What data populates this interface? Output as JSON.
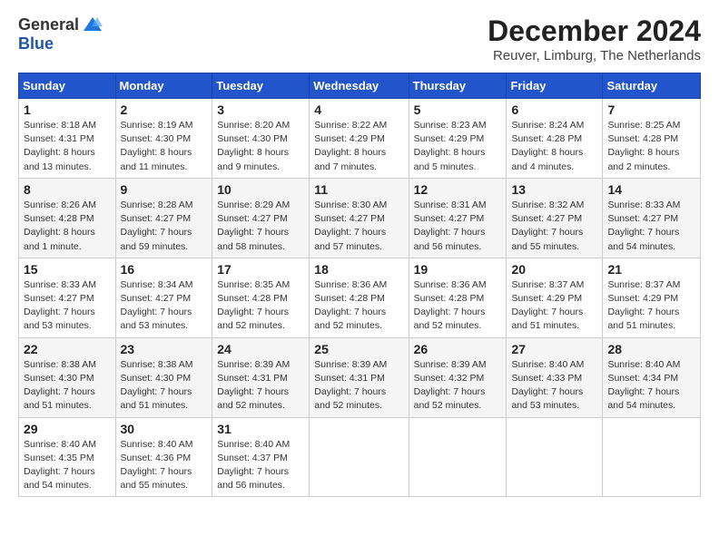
{
  "logo": {
    "general": "General",
    "blue": "Blue"
  },
  "title": "December 2024",
  "location": "Reuver, Limburg, The Netherlands",
  "weekdays": [
    "Sunday",
    "Monday",
    "Tuesday",
    "Wednesday",
    "Thursday",
    "Friday",
    "Saturday"
  ],
  "weeks": [
    [
      {
        "day": 1,
        "sunrise": "8:18 AM",
        "sunset": "4:31 PM",
        "daylight": "8 hours and 13 minutes."
      },
      {
        "day": 2,
        "sunrise": "8:19 AM",
        "sunset": "4:30 PM",
        "daylight": "8 hours and 11 minutes."
      },
      {
        "day": 3,
        "sunrise": "8:20 AM",
        "sunset": "4:30 PM",
        "daylight": "8 hours and 9 minutes."
      },
      {
        "day": 4,
        "sunrise": "8:22 AM",
        "sunset": "4:29 PM",
        "daylight": "8 hours and 7 minutes."
      },
      {
        "day": 5,
        "sunrise": "8:23 AM",
        "sunset": "4:29 PM",
        "daylight": "8 hours and 5 minutes."
      },
      {
        "day": 6,
        "sunrise": "8:24 AM",
        "sunset": "4:28 PM",
        "daylight": "8 hours and 4 minutes."
      },
      {
        "day": 7,
        "sunrise": "8:25 AM",
        "sunset": "4:28 PM",
        "daylight": "8 hours and 2 minutes."
      }
    ],
    [
      {
        "day": 8,
        "sunrise": "8:26 AM",
        "sunset": "4:28 PM",
        "daylight": "8 hours and 1 minute."
      },
      {
        "day": 9,
        "sunrise": "8:28 AM",
        "sunset": "4:27 PM",
        "daylight": "7 hours and 59 minutes."
      },
      {
        "day": 10,
        "sunrise": "8:29 AM",
        "sunset": "4:27 PM",
        "daylight": "7 hours and 58 minutes."
      },
      {
        "day": 11,
        "sunrise": "8:30 AM",
        "sunset": "4:27 PM",
        "daylight": "7 hours and 57 minutes."
      },
      {
        "day": 12,
        "sunrise": "8:31 AM",
        "sunset": "4:27 PM",
        "daylight": "7 hours and 56 minutes."
      },
      {
        "day": 13,
        "sunrise": "8:32 AM",
        "sunset": "4:27 PM",
        "daylight": "7 hours and 55 minutes."
      },
      {
        "day": 14,
        "sunrise": "8:33 AM",
        "sunset": "4:27 PM",
        "daylight": "7 hours and 54 minutes."
      }
    ],
    [
      {
        "day": 15,
        "sunrise": "8:33 AM",
        "sunset": "4:27 PM",
        "daylight": "7 hours and 53 minutes."
      },
      {
        "day": 16,
        "sunrise": "8:34 AM",
        "sunset": "4:27 PM",
        "daylight": "7 hours and 53 minutes."
      },
      {
        "day": 17,
        "sunrise": "8:35 AM",
        "sunset": "4:28 PM",
        "daylight": "7 hours and 52 minutes."
      },
      {
        "day": 18,
        "sunrise": "8:36 AM",
        "sunset": "4:28 PM",
        "daylight": "7 hours and 52 minutes."
      },
      {
        "day": 19,
        "sunrise": "8:36 AM",
        "sunset": "4:28 PM",
        "daylight": "7 hours and 52 minutes."
      },
      {
        "day": 20,
        "sunrise": "8:37 AM",
        "sunset": "4:29 PM",
        "daylight": "7 hours and 51 minutes."
      },
      {
        "day": 21,
        "sunrise": "8:37 AM",
        "sunset": "4:29 PM",
        "daylight": "7 hours and 51 minutes."
      }
    ],
    [
      {
        "day": 22,
        "sunrise": "8:38 AM",
        "sunset": "4:30 PM",
        "daylight": "7 hours and 51 minutes."
      },
      {
        "day": 23,
        "sunrise": "8:38 AM",
        "sunset": "4:30 PM",
        "daylight": "7 hours and 51 minutes."
      },
      {
        "day": 24,
        "sunrise": "8:39 AM",
        "sunset": "4:31 PM",
        "daylight": "7 hours and 52 minutes."
      },
      {
        "day": 25,
        "sunrise": "8:39 AM",
        "sunset": "4:31 PM",
        "daylight": "7 hours and 52 minutes."
      },
      {
        "day": 26,
        "sunrise": "8:39 AM",
        "sunset": "4:32 PM",
        "daylight": "7 hours and 52 minutes."
      },
      {
        "day": 27,
        "sunrise": "8:40 AM",
        "sunset": "4:33 PM",
        "daylight": "7 hours and 53 minutes."
      },
      {
        "day": 28,
        "sunrise": "8:40 AM",
        "sunset": "4:34 PM",
        "daylight": "7 hours and 54 minutes."
      }
    ],
    [
      {
        "day": 29,
        "sunrise": "8:40 AM",
        "sunset": "4:35 PM",
        "daylight": "7 hours and 54 minutes."
      },
      {
        "day": 30,
        "sunrise": "8:40 AM",
        "sunset": "4:36 PM",
        "daylight": "7 hours and 55 minutes."
      },
      {
        "day": 31,
        "sunrise": "8:40 AM",
        "sunset": "4:37 PM",
        "daylight": "7 hours and 56 minutes."
      },
      null,
      null,
      null,
      null
    ]
  ],
  "labels": {
    "sunrise": "Sunrise:",
    "sunset": "Sunset:",
    "daylight": "Daylight:"
  }
}
